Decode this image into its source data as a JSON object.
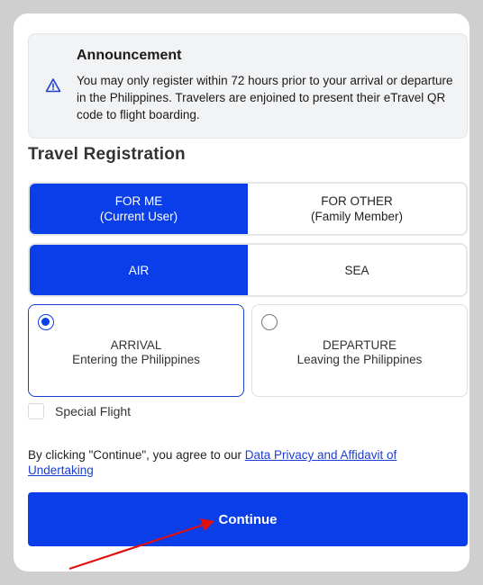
{
  "announcement": {
    "title": "Announcement",
    "body": "You may only register within 72 hours prior to your arrival or departure in the Philippines. Travelers are enjoined to present their eTravel QR code to flight boarding.",
    "icon": "warning-icon"
  },
  "registration": {
    "title": "Travel Registration",
    "who": [
      {
        "line1": "FOR ME",
        "line2": "(Current User)",
        "selected": true
      },
      {
        "line1": "FOR OTHER",
        "line2": "(Family Member)",
        "selected": false
      }
    ],
    "mode": [
      {
        "label": "AIR",
        "selected": true
      },
      {
        "label": "SEA",
        "selected": false
      }
    ],
    "direction": [
      {
        "label": "ARRIVAL",
        "sub": "Entering the Philippines",
        "selected": true
      },
      {
        "label": "DEPARTURE",
        "sub": "Leaving the Philippines",
        "selected": false
      }
    ],
    "special_flight_label": "Special Flight"
  },
  "consent": {
    "prefix": "By clicking \"Continue\", you agree to our ",
    "link_text": "Data Privacy and Affidavit of Undertaking"
  },
  "continue_label": "Continue",
  "colors": {
    "primary": "#0a3ee8",
    "annotation_arrow": "#e01010"
  }
}
